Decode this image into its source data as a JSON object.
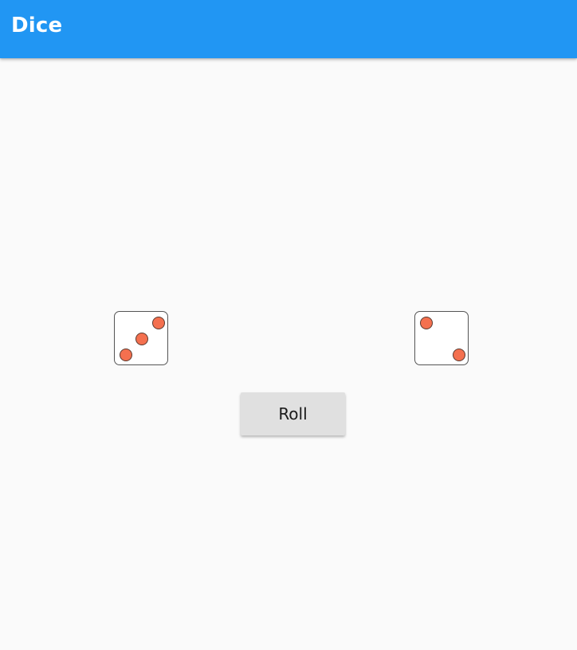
{
  "app_bar": {
    "title": "Dice",
    "color": "#2196f3"
  },
  "dice": [
    {
      "value": 3
    },
    {
      "value": 2
    }
  ],
  "pip_color": "#f4704f",
  "roll_button": {
    "label": "Roll"
  }
}
